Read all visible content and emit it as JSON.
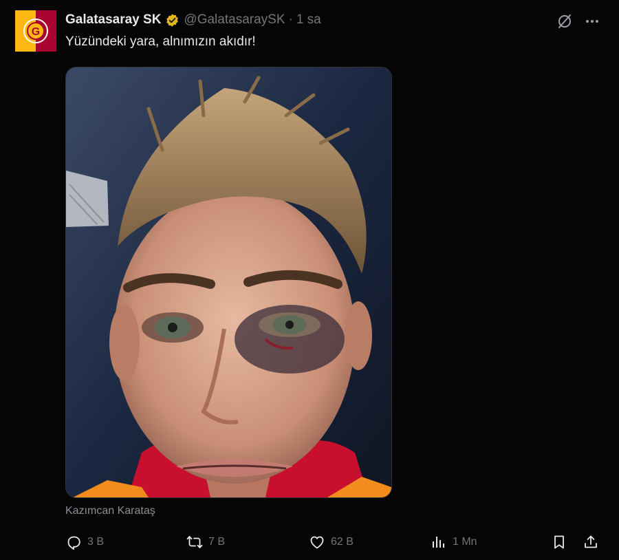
{
  "account": {
    "display_name": "Galatasaray SK",
    "handle": "@GalatasaraySK",
    "separator": "·",
    "time": "1 sa",
    "verified": true,
    "avatar_letter": "G"
  },
  "tweet": {
    "text": "Yüzündeki yara, alnımızın akıdır!"
  },
  "media": {
    "caption": "Kazımcan Karataş"
  },
  "top_icons": [
    "grok-icon",
    "more-icon"
  ],
  "actions": {
    "replies": "3 B",
    "reposts": "7 B",
    "likes": "62 B",
    "views": "1 Mn"
  },
  "colors": {
    "background": "#050505",
    "text": "#e7e9ea",
    "secondary": "#71767b",
    "verified_gold": "#e2b719",
    "club_red": "#a90432",
    "club_yellow": "#fdb912"
  }
}
